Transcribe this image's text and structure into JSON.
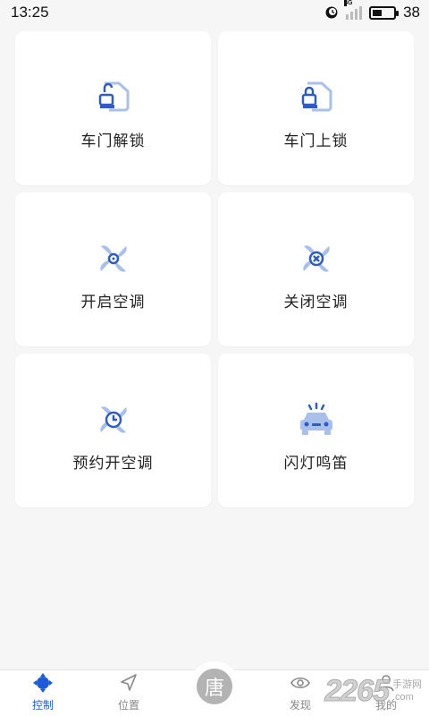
{
  "status_bar": {
    "time": "13:25",
    "network": "4G",
    "battery_level": "38",
    "icons": [
      "alarm-icon",
      "signal-icon",
      "battery-icon"
    ]
  },
  "controls": [
    {
      "label": "车门解锁",
      "icon": "unlock-door-icon"
    },
    {
      "label": "车门上锁",
      "icon": "lock-door-icon"
    },
    {
      "label": "开启空调",
      "icon": "fan-on-icon"
    },
    {
      "label": "关闭空调",
      "icon": "fan-off-icon"
    },
    {
      "label": "预约开空调",
      "icon": "fan-schedule-icon"
    },
    {
      "label": "闪灯鸣笛",
      "icon": "car-flash-horn-icon"
    }
  ],
  "bottom_nav": {
    "items": [
      {
        "label": "控制",
        "icon": "control-icon",
        "active": true
      },
      {
        "label": "位置",
        "icon": "location-arrow-icon",
        "active": false
      },
      {
        "label": "发现",
        "icon": "eye-icon",
        "active": false
      },
      {
        "label": "我的",
        "icon": "user-icon",
        "active": false
      }
    ],
    "center_brand": "唐"
  },
  "watermark": {
    "number": "2265",
    "suffix": ".com",
    "site": "手游网"
  },
  "colors": {
    "accent": "#1e5bd8",
    "icon_dark": "#2f5cc4",
    "icon_light": "#a9c0ea",
    "background": "#f6f6f7",
    "card": "#ffffff",
    "nav_inactive": "#888888"
  }
}
